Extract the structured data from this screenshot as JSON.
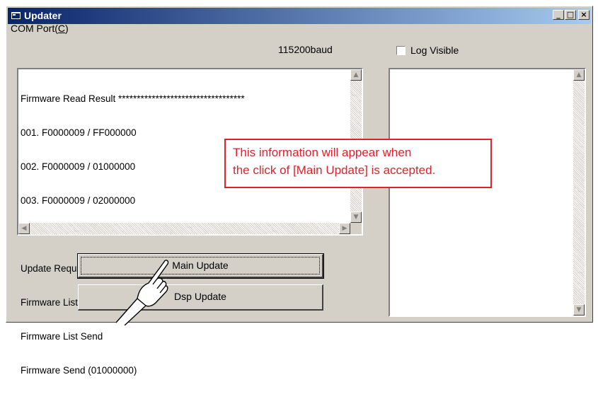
{
  "window": {
    "title": "Updater"
  },
  "menu": {
    "com_port_prefix": "COM Port(",
    "com_port_key": "C",
    "com_port_suffix": ")"
  },
  "baud": {
    "text": "115200baud"
  },
  "log_visible": {
    "label": "Log Visible",
    "checked": false
  },
  "log_lines": [
    "Firmware Read Result **********************************",
    "001. F0000009 / FF000000",
    "002. F0000009 / 01000000",
    "003. F0000009 / 02000000",
    "**************************************************",
    "Update Request Recieve (F0000009)",
    "Firmware List Send",
    "Firmware List Send",
    "Firmware Send (01000000)"
  ],
  "buttons": {
    "main_update": "Main Update",
    "dsp_update": "Dsp Update"
  },
  "callout": {
    "line1": "This information will appear when",
    "line2": "the click of [Main Update] is accepted."
  },
  "colors": {
    "title_start": "#0a246a",
    "title_end": "#a6caf0",
    "callout": "#e0202a"
  },
  "icons": [
    "app-icon",
    "minimize-icon",
    "maximize-icon",
    "close-icon",
    "scroll-up-icon",
    "scroll-down-icon",
    "scroll-left-icon",
    "scroll-right-icon",
    "pointing-hand-icon"
  ]
}
